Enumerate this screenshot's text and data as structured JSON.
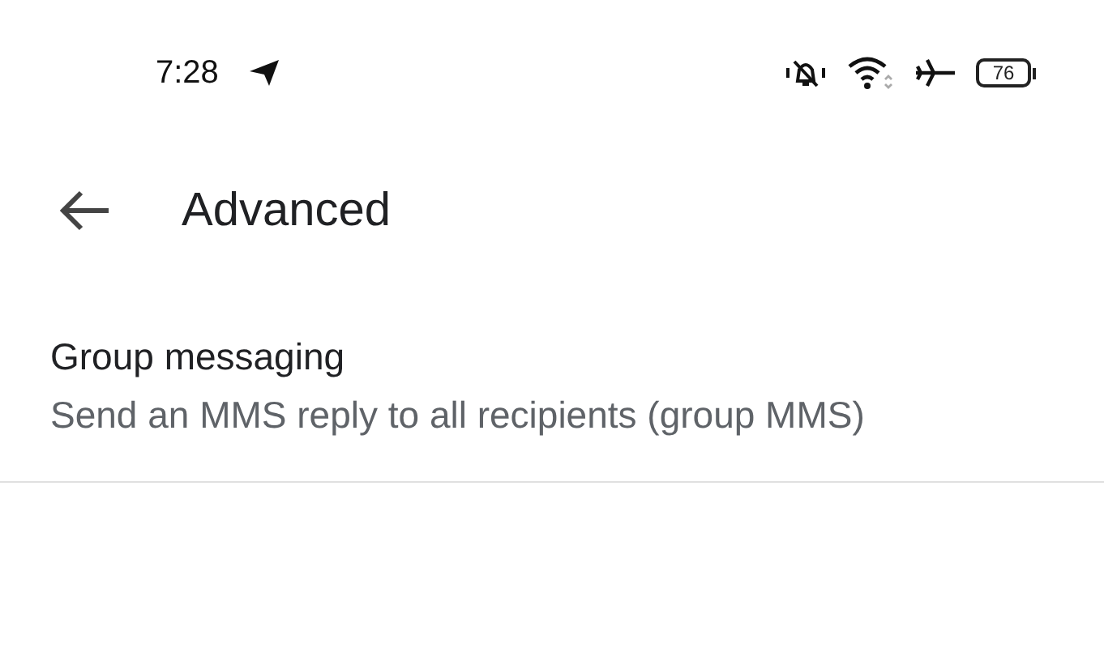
{
  "status_bar": {
    "time": "7:28",
    "battery": "76"
  },
  "app_bar": {
    "title": "Advanced"
  },
  "settings": [
    {
      "title": "Group messaging",
      "summary": "Send an MMS reply to all recipients (group MMS)"
    }
  ]
}
